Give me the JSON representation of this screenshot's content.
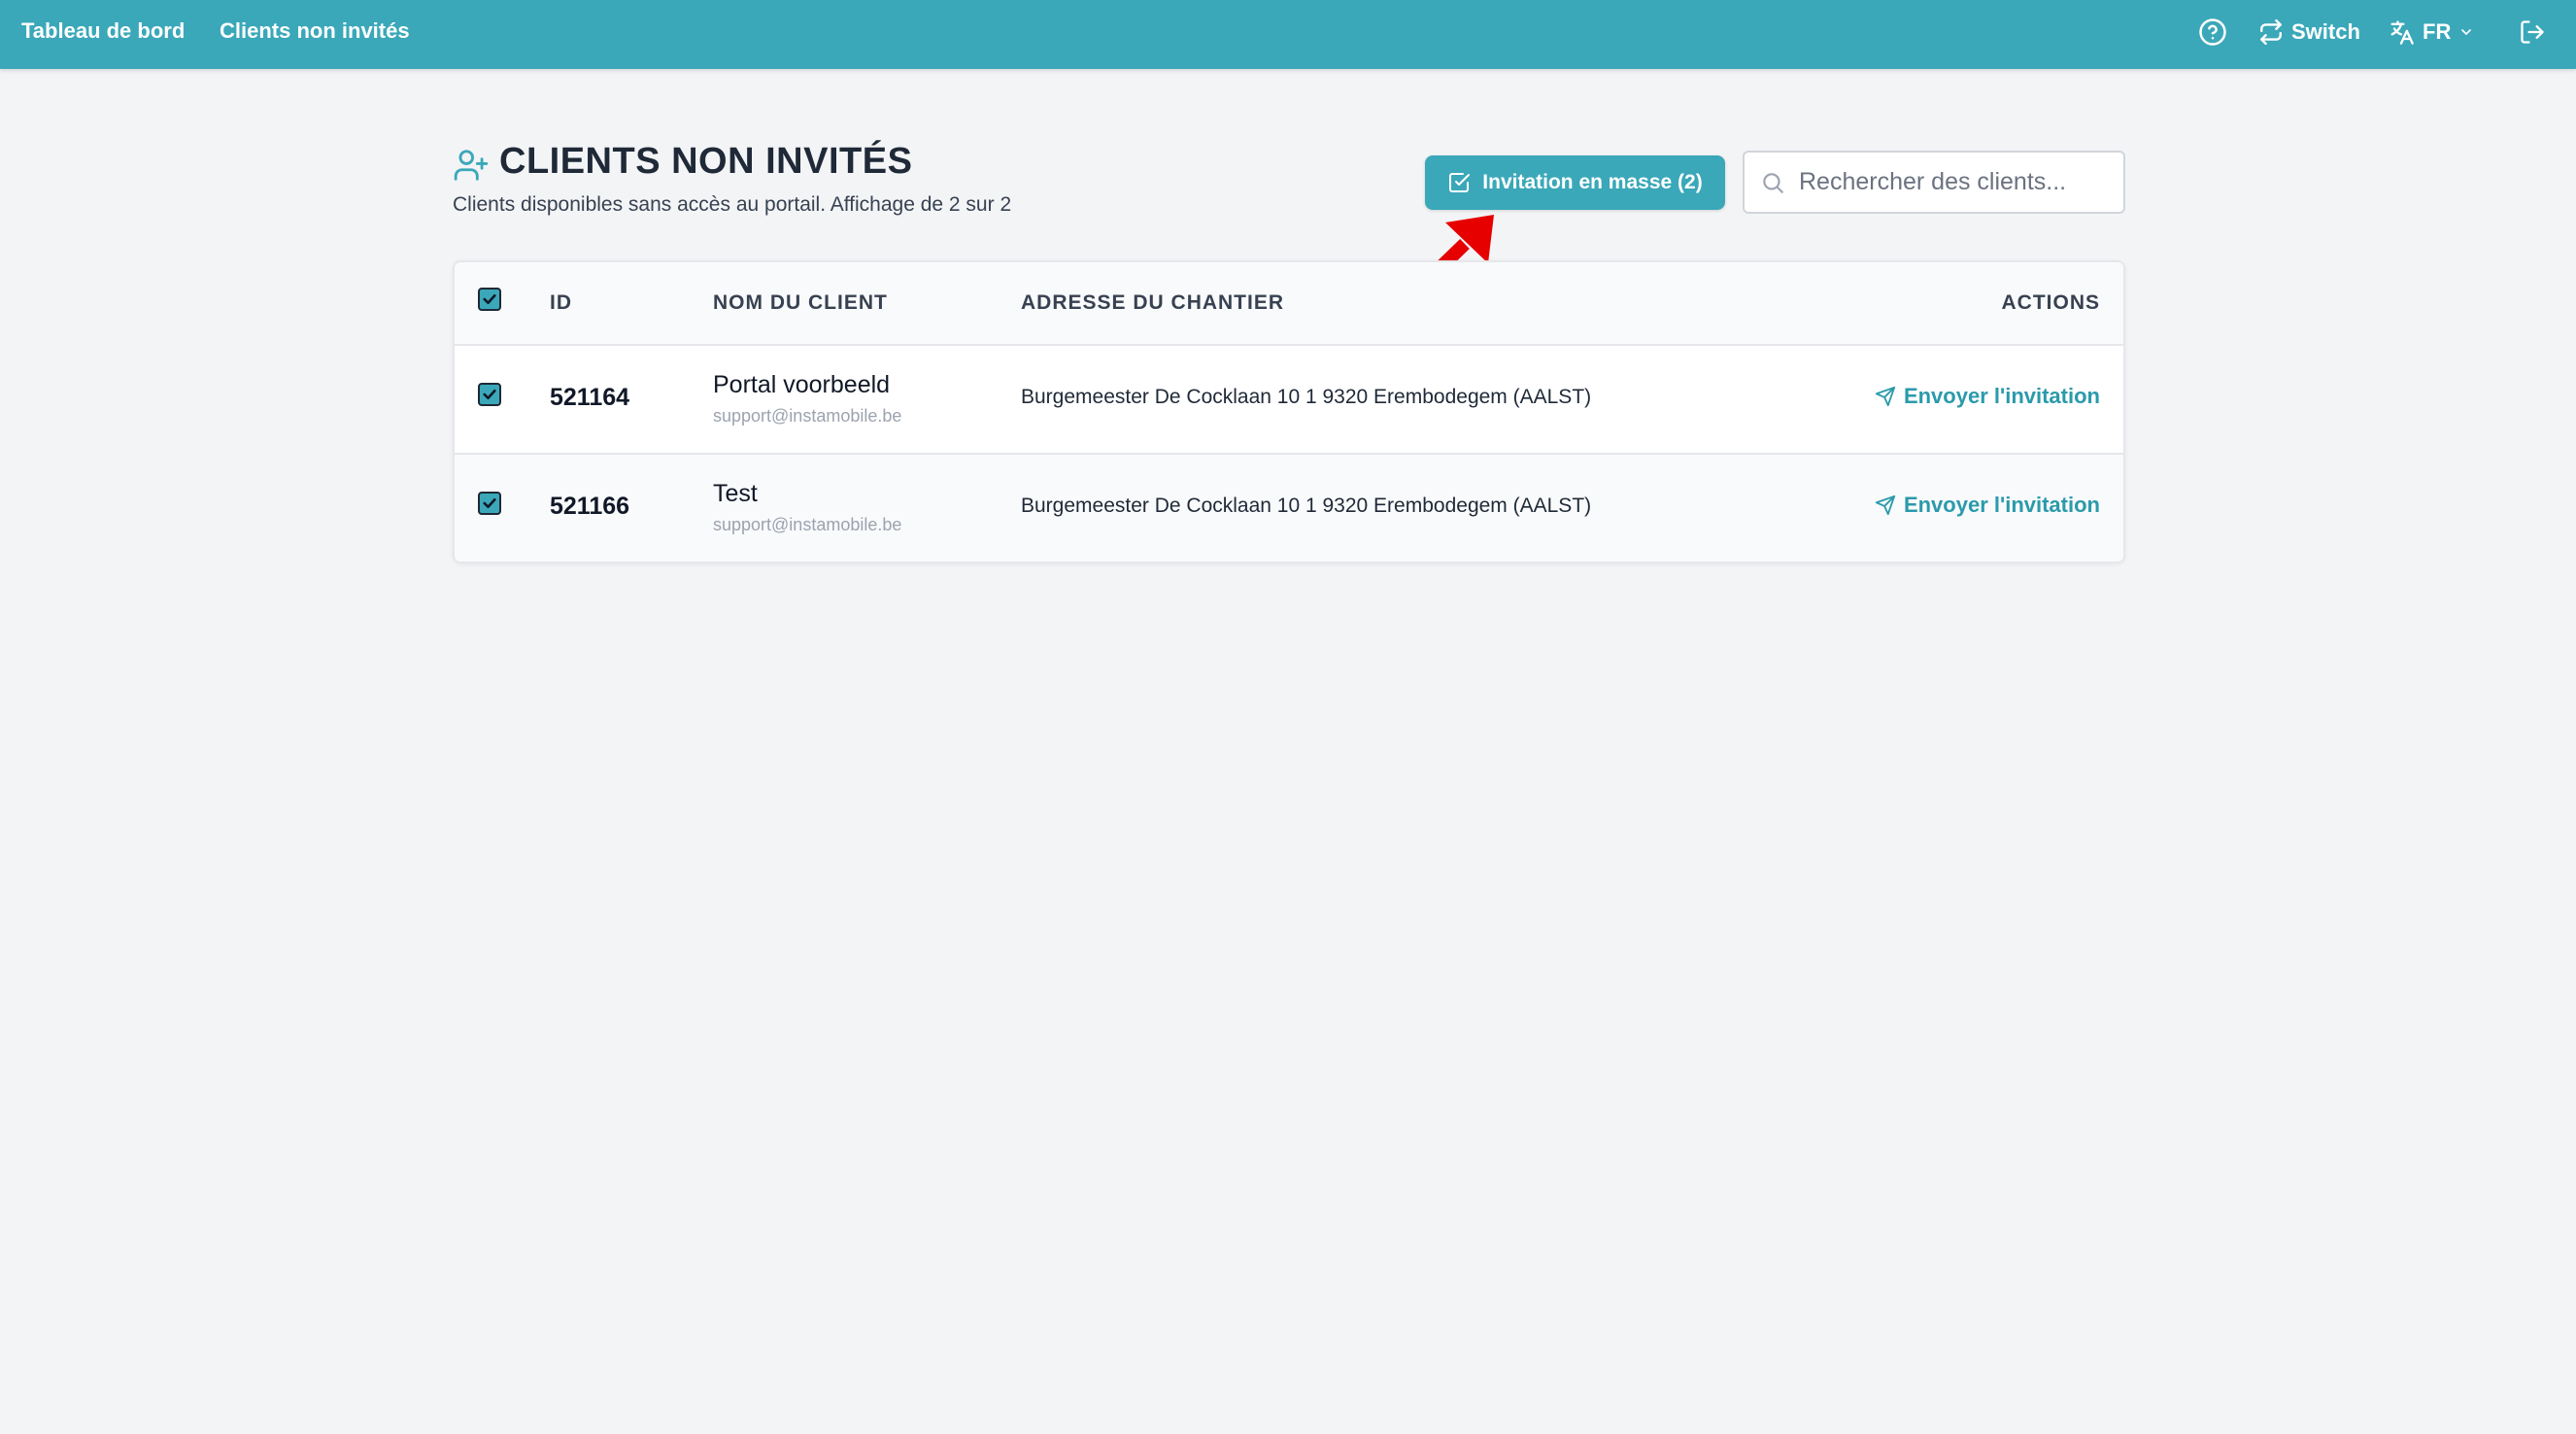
{
  "nav": {
    "links": [
      {
        "label": "Tableau de bord"
      },
      {
        "label": "Clients non invités"
      }
    ],
    "switch_label": "Switch",
    "language": "FR"
  },
  "header": {
    "title": "CLIENTS NON INVITÉS",
    "subtitle": "Clients disponibles sans accès au portail. Affichage de 2 sur 2",
    "bulk_button_label": "Invitation en masse (2)",
    "search_placeholder": "Rechercher des clients..."
  },
  "table": {
    "columns": [
      "ID",
      "NOM DU CLIENT",
      "ADRESSE DU CHANTIER",
      "ACTIONS"
    ],
    "select_all_checked": true,
    "rows": [
      {
        "checked": true,
        "id": "521164",
        "name": "Portal voorbeeld",
        "email": "support@instamobile.be",
        "address": "Burgemeester De Cocklaan 10 1 9320 Erembodegem (AALST)",
        "action": "Envoyer l'invitation"
      },
      {
        "checked": true,
        "id": "521166",
        "name": "Test",
        "email": "support@instamobile.be",
        "address": "Burgemeester De Cocklaan 10 1 9320 Erembodegem (AALST)",
        "action": "Envoyer l'invitation"
      }
    ]
  },
  "colors": {
    "accent": "#3aa8b9",
    "background": "#f3f4f6",
    "annotation": "#e60000"
  },
  "icons": [
    "user-plus-icon",
    "help-circle-icon",
    "switch-arrows-icon",
    "translate-icon",
    "chevron-down-icon",
    "logout-icon",
    "check-square-icon",
    "search-icon",
    "send-icon",
    "checkbox-checked-icon",
    "annotation-arrow"
  ]
}
